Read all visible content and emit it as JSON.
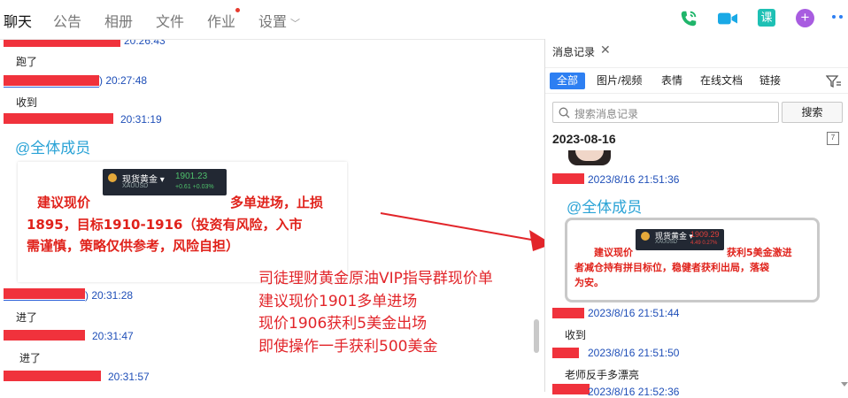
{
  "top_tabs": [
    {
      "label": "聊天",
      "active": true
    },
    {
      "label": "公告"
    },
    {
      "label": "相册"
    },
    {
      "label": "文件"
    },
    {
      "label": "作业"
    },
    {
      "label": "设置"
    }
  ],
  "top_icons": {
    "course_label": "课"
  },
  "chat": {
    "messages": [
      {
        "time": "20:26:43"
      },
      {
        "text": "跑了"
      },
      {
        "time": ") 20:27:48"
      },
      {
        "text": "收到"
      },
      {
        "time": "20:31:19"
      },
      {
        "mention": "@全体成员"
      },
      {
        "time": ") 20:31:28"
      },
      {
        "text": "进了"
      },
      {
        "time": "20:31:47"
      },
      {
        "text": "进了"
      },
      {
        "time": "20:31:57"
      }
    ],
    "card": {
      "quote_name": "现货黄金 ▾",
      "quote_code": "XAUUSD",
      "quote_price": "1901.23",
      "quote_change": "+0.61  +0.03%",
      "line1_a": "建议现价",
      "line1_b": "多单进场，止损",
      "line2": "1895，目标1910-1916（投资有风险，入市",
      "line3": "需谨慎，策略仅供参考，风险自担）"
    },
    "overlay": [
      "司徒理财黄金原油VIP指导群现价单",
      "建议现价1901多单进场",
      "现价1906获利5美金出场",
      "即使操作一手获利500美金"
    ]
  },
  "panel": {
    "tab_label": "消息记录",
    "filters": [
      "全部",
      "图片/视频",
      "表情",
      "在线文档",
      "链接"
    ],
    "search_placeholder": "搜索消息记录",
    "search_button": "搜索",
    "date": "2023-08-16",
    "cal_day": "7",
    "entries": [
      {
        "time": "2023/8/16 21:51:36"
      },
      {
        "mention": "@全体成员"
      },
      {
        "time": "2023/8/16 21:51:44"
      },
      {
        "text": "收到"
      },
      {
        "time": "2023/8/16 21:51:50"
      },
      {
        "text": "老师反手多漂亮"
      },
      {
        "time": "2023/8/16 21:52:36"
      }
    ],
    "card": {
      "quote_name": "现货黄金 ▾",
      "quote_code": "XAUUSD",
      "quote_price": "1909.29",
      "quote_change": "4.49  0.27%",
      "line1_a": "建议现价",
      "line1_b": "获利5美金激进",
      "line2": "者减仓持有拼目标位，稳健者获利出局，落袋",
      "line3": "为安。"
    }
  },
  "colors": {
    "accent": "#2d7ff2",
    "redact": "#f0323c",
    "time": "#1f4fb8",
    "mention": "#2aa3d6",
    "overlay": "#e2252a"
  }
}
